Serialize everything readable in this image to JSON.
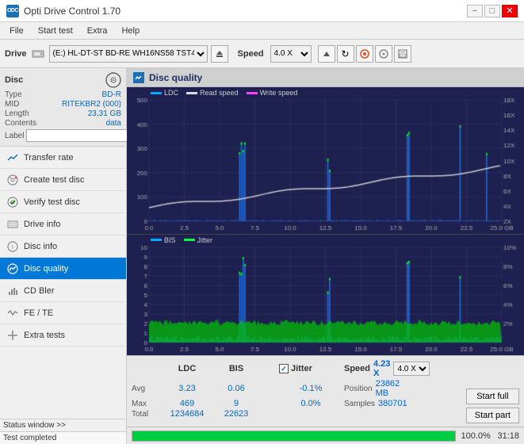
{
  "app": {
    "title": "Opti Drive Control 1.70",
    "icon": "ODC"
  },
  "titlebar": {
    "title": "Opti Drive Control 1.70",
    "minimize": "−",
    "maximize": "□",
    "close": "✕"
  },
  "menubar": {
    "items": [
      "File",
      "Start test",
      "Extra",
      "Help"
    ]
  },
  "drive": {
    "label": "Drive",
    "selector": "(E:)  HL-DT-ST BD-RE  WH16NS58 TST4",
    "speed_label": "Speed",
    "speed_value": "4.0 X"
  },
  "disc": {
    "title": "Disc",
    "type_label": "Type",
    "type_value": "BD-R",
    "mid_label": "MID",
    "mid_value": "RITEKBR2 (000)",
    "length_label": "Length",
    "length_value": "23,31 GB",
    "contents_label": "Contents",
    "contents_value": "data",
    "label_label": "Label"
  },
  "nav": {
    "items": [
      {
        "id": "transfer-rate",
        "label": "Transfer rate",
        "icon": "📈"
      },
      {
        "id": "create-test-disc",
        "label": "Create test disc",
        "icon": "💿"
      },
      {
        "id": "verify-test-disc",
        "label": "Verify test disc",
        "icon": "✔"
      },
      {
        "id": "drive-info",
        "label": "Drive info",
        "icon": "ℹ"
      },
      {
        "id": "disc-info",
        "label": "Disc info",
        "icon": "📋"
      },
      {
        "id": "disc-quality",
        "label": "Disc quality",
        "icon": "⭐",
        "active": true
      },
      {
        "id": "cd-bler",
        "label": "CD Bler",
        "icon": "📊"
      },
      {
        "id": "fe-te",
        "label": "FE / TE",
        "icon": "📉"
      },
      {
        "id": "extra-tests",
        "label": "Extra tests",
        "icon": "🔧"
      }
    ]
  },
  "status_window": {
    "label": "Status window >>",
    "status_text": "Test completed"
  },
  "disc_quality": {
    "title": "Disc quality",
    "legend": {
      "ldc": "LDC",
      "read_speed": "Read speed",
      "write_speed": "Write speed",
      "bis": "BIS",
      "jitter": "Jitter"
    },
    "top_chart": {
      "y_max": 500,
      "y_labels": [
        "500",
        "400",
        "300",
        "200",
        "100"
      ],
      "y_right_labels": [
        "18X",
        "16X",
        "14X",
        "12X",
        "10X",
        "8X",
        "6X",
        "4X",
        "2X"
      ],
      "x_labels": [
        "0.0",
        "2.5",
        "5.0",
        "7.5",
        "10.0",
        "12.5",
        "15.0",
        "17.5",
        "20.0",
        "22.5",
        "25.0 GB"
      ]
    },
    "bottom_chart": {
      "y_max": 10,
      "y_labels": [
        "10",
        "9",
        "8",
        "7",
        "6",
        "5",
        "4",
        "3",
        "2",
        "1"
      ],
      "y_right_labels": [
        "10%",
        "8%",
        "6%",
        "4%",
        "2%"
      ],
      "x_labels": [
        "0.0",
        "2.5",
        "5.0",
        "7.5",
        "10.0",
        "12.5",
        "15.0",
        "17.5",
        "20.0",
        "22.5",
        "25.0 GB"
      ]
    }
  },
  "stats": {
    "headers": [
      "LDC",
      "BIS",
      "",
      "Jitter",
      "Speed"
    ],
    "jitter_checked": true,
    "jitter_label": "Jitter",
    "speed_label": "Speed",
    "speed_value": "4.23 X",
    "speed_select": "4.0 X",
    "position_label": "Position",
    "position_value": "23862 MB",
    "samples_label": "Samples",
    "samples_value": "380701",
    "rows": [
      {
        "label": "Avg",
        "ldc": "3.23",
        "bis": "0.06",
        "jitter": "-0.1%"
      },
      {
        "label": "Max",
        "ldc": "469",
        "bis": "9",
        "jitter": "0.0%"
      },
      {
        "label": "Total",
        "ldc": "1234684",
        "bis": "22623",
        "jitter": ""
      }
    ],
    "start_full": "Start full",
    "start_part": "Start part"
  },
  "progress": {
    "percent": "100.0%",
    "fill_width": "100",
    "time": "31:18"
  }
}
